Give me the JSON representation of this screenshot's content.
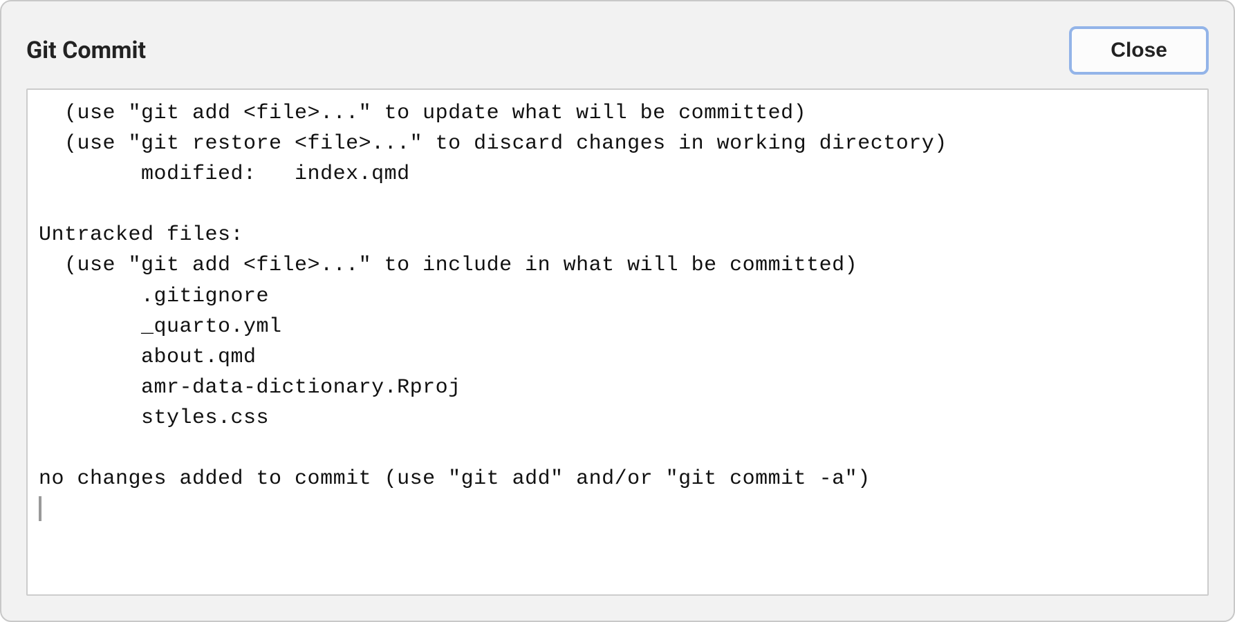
{
  "dialog": {
    "title": "Git Commit",
    "close_label": "Close"
  },
  "terminal": {
    "lines": [
      "  (use \"git add <file>...\" to update what will be committed)",
      "  (use \"git restore <file>...\" to discard changes in working directory)",
      "        modified:   index.qmd",
      "",
      "Untracked files:",
      "  (use \"git add <file>...\" to include in what will be committed)",
      "        .gitignore",
      "        _quarto.yml",
      "        about.qmd",
      "        amr-data-dictionary.Rproj",
      "        styles.css",
      "",
      "no changes added to commit (use \"git add\" and/or \"git commit -a\")"
    ]
  }
}
